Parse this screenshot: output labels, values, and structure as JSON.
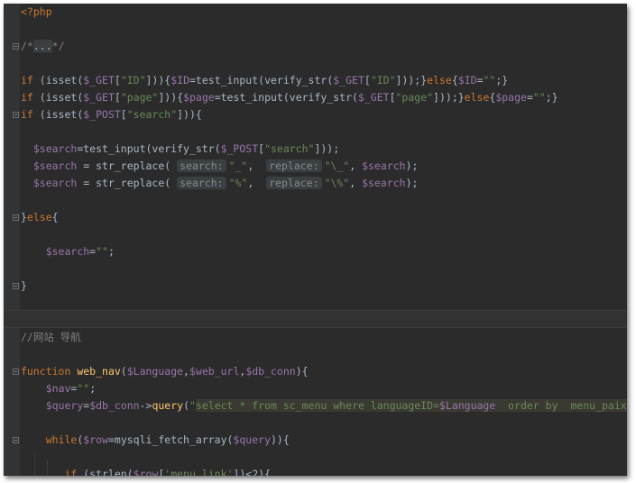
{
  "editor": {
    "background": "#2b2b2b",
    "colors": {
      "keyword": "#cc7832",
      "variable": "#9876aa",
      "string": "#6a8759",
      "function": "#ffc66d",
      "comment": "#808080",
      "text": "#a9b7c6"
    },
    "lines": [
      [
        {
          "t": "k",
          "v": "<?php"
        }
      ],
      [],
      [
        {
          "t": "c",
          "v": "/*"
        },
        {
          "t": "collapsed",
          "v": "..."
        },
        {
          "t": "c",
          "v": "*/"
        }
      ],
      [],
      [
        {
          "t": "k",
          "v": "if"
        },
        {
          "t": "p",
          "v": " (isset("
        },
        {
          "t": "v",
          "v": "$_GET"
        },
        {
          "t": "p",
          "v": "["
        },
        {
          "t": "s",
          "v": "\"ID\""
        },
        {
          "t": "p",
          "v": "])){"
        },
        {
          "t": "v",
          "v": "$ID"
        },
        {
          "t": "p",
          "v": "=test_input(verify_str("
        },
        {
          "t": "v",
          "v": "$_GET"
        },
        {
          "t": "p",
          "v": "["
        },
        {
          "t": "s",
          "v": "\"ID\""
        },
        {
          "t": "p",
          "v": "]));}"
        },
        {
          "t": "k",
          "v": "else"
        },
        {
          "t": "p",
          "v": "{"
        },
        {
          "t": "v",
          "v": "$ID"
        },
        {
          "t": "p",
          "v": "="
        },
        {
          "t": "s",
          "v": "\"\""
        },
        {
          "t": "p",
          "v": ";}"
        }
      ],
      [
        {
          "t": "k",
          "v": "if"
        },
        {
          "t": "p",
          "v": " (isset("
        },
        {
          "t": "v",
          "v": "$_GET"
        },
        {
          "t": "p",
          "v": "["
        },
        {
          "t": "s",
          "v": "\"page\""
        },
        {
          "t": "p",
          "v": "])){"
        },
        {
          "t": "v",
          "v": "$page"
        },
        {
          "t": "p",
          "v": "=test_input(verify_str("
        },
        {
          "t": "v",
          "v": "$_GET"
        },
        {
          "t": "p",
          "v": "["
        },
        {
          "t": "s",
          "v": "\"page\""
        },
        {
          "t": "p",
          "v": "]));}"
        },
        {
          "t": "k",
          "v": "else"
        },
        {
          "t": "p",
          "v": "{"
        },
        {
          "t": "v",
          "v": "$page"
        },
        {
          "t": "p",
          "v": "="
        },
        {
          "t": "s",
          "v": "\"\""
        },
        {
          "t": "p",
          "v": ";}"
        }
      ],
      [
        {
          "t": "k",
          "v": "if"
        },
        {
          "t": "p",
          "v": " (isset("
        },
        {
          "t": "v",
          "v": "$_POST"
        },
        {
          "t": "p",
          "v": "["
        },
        {
          "t": "s",
          "v": "\"search\""
        },
        {
          "t": "p",
          "v": "])){"
        }
      ],
      [],
      [
        {
          "t": "p",
          "v": "  "
        },
        {
          "t": "v",
          "v": "$search"
        },
        {
          "t": "p",
          "v": "=test_input(verify_str("
        },
        {
          "t": "v",
          "v": "$_POST"
        },
        {
          "t": "p",
          "v": "["
        },
        {
          "t": "s",
          "v": "\"search\""
        },
        {
          "t": "p",
          "v": "]));"
        }
      ],
      [
        {
          "t": "p",
          "v": "  "
        },
        {
          "t": "v",
          "v": "$search"
        },
        {
          "t": "p",
          "v": " = str_replace( "
        },
        {
          "t": "hint",
          "v": "search:"
        },
        {
          "t": "s",
          "v": "\"_\""
        },
        {
          "t": "p",
          "v": ",  "
        },
        {
          "t": "hint",
          "v": "replace:"
        },
        {
          "t": "s",
          "v": "\"\\_\""
        },
        {
          "t": "p",
          "v": ", "
        },
        {
          "t": "v",
          "v": "$search"
        },
        {
          "t": "p",
          "v": ");"
        }
      ],
      [
        {
          "t": "p",
          "v": "  "
        },
        {
          "t": "v",
          "v": "$search"
        },
        {
          "t": "p",
          "v": " = str_replace( "
        },
        {
          "t": "hint",
          "v": "search:"
        },
        {
          "t": "s",
          "v": "\"%\""
        },
        {
          "t": "p",
          "v": ",  "
        },
        {
          "t": "hint",
          "v": "replace:"
        },
        {
          "t": "s",
          "v": "\"\\%\""
        },
        {
          "t": "p",
          "v": ", "
        },
        {
          "t": "v",
          "v": "$search"
        },
        {
          "t": "p",
          "v": ");"
        }
      ],
      [],
      [
        {
          "t": "p",
          "v": "}"
        },
        {
          "t": "k",
          "v": "else"
        },
        {
          "t": "p",
          "v": "{"
        }
      ],
      [],
      [
        {
          "t": "p",
          "v": "    "
        },
        {
          "t": "v",
          "v": "$search"
        },
        {
          "t": "p",
          "v": "="
        },
        {
          "t": "s",
          "v": "\"\""
        },
        {
          "t": "p",
          "v": ";"
        }
      ],
      [],
      [
        {
          "t": "p",
          "v": "}"
        }
      ],
      [],
      [],
      [
        {
          "t": "c",
          "v": "//网站 导航"
        }
      ],
      [],
      [
        {
          "t": "k",
          "v": "function"
        },
        {
          "t": "p",
          "v": " "
        },
        {
          "t": "f",
          "v": "web_nav"
        },
        {
          "t": "p",
          "v": "("
        },
        {
          "t": "v",
          "v": "$Language"
        },
        {
          "t": "p",
          "v": ","
        },
        {
          "t": "v",
          "v": "$web_url"
        },
        {
          "t": "p",
          "v": ","
        },
        {
          "t": "v",
          "v": "$db_conn"
        },
        {
          "t": "p",
          "v": "){"
        }
      ],
      [
        {
          "t": "p",
          "v": "    "
        },
        {
          "t": "v",
          "v": "$nav"
        },
        {
          "t": "p",
          "v": "="
        },
        {
          "t": "s",
          "v": "\"\""
        },
        {
          "t": "p",
          "v": ";"
        }
      ],
      [
        {
          "t": "p",
          "v": "    "
        },
        {
          "t": "v",
          "v": "$query"
        },
        {
          "t": "p",
          "v": "="
        },
        {
          "t": "v",
          "v": "$db_conn"
        },
        {
          "t": "p",
          "v": "->"
        },
        {
          "t": "f",
          "v": "query"
        },
        {
          "t": "p",
          "v": "("
        },
        {
          "t": "s",
          "v": "\""
        },
        {
          "t": "sql",
          "v": "select * from sc_menu where languageID="
        },
        {
          "t": "sqlv",
          "v": "$Language"
        },
        {
          "t": "sql",
          "v": "  order by  menu_paixu"
        }
      ],
      [],
      [
        {
          "t": "p",
          "v": "    "
        },
        {
          "t": "k",
          "v": "while"
        },
        {
          "t": "p",
          "v": "("
        },
        {
          "t": "v",
          "v": "$row"
        },
        {
          "t": "p",
          "v": "=mysqli_fetch_array("
        },
        {
          "t": "v",
          "v": "$query"
        },
        {
          "t": "p",
          "v": ")){"
        }
      ],
      [],
      [
        {
          "t": "p",
          "v": "       "
        },
        {
          "t": "k",
          "v": "if"
        },
        {
          "t": "p",
          "v": " (strlen("
        },
        {
          "t": "v",
          "v": "$row"
        },
        {
          "t": "p",
          "v": "["
        },
        {
          "t": "s",
          "v": "'menu_link'"
        },
        {
          "t": "p",
          "v": "])<2){"
        }
      ]
    ]
  }
}
